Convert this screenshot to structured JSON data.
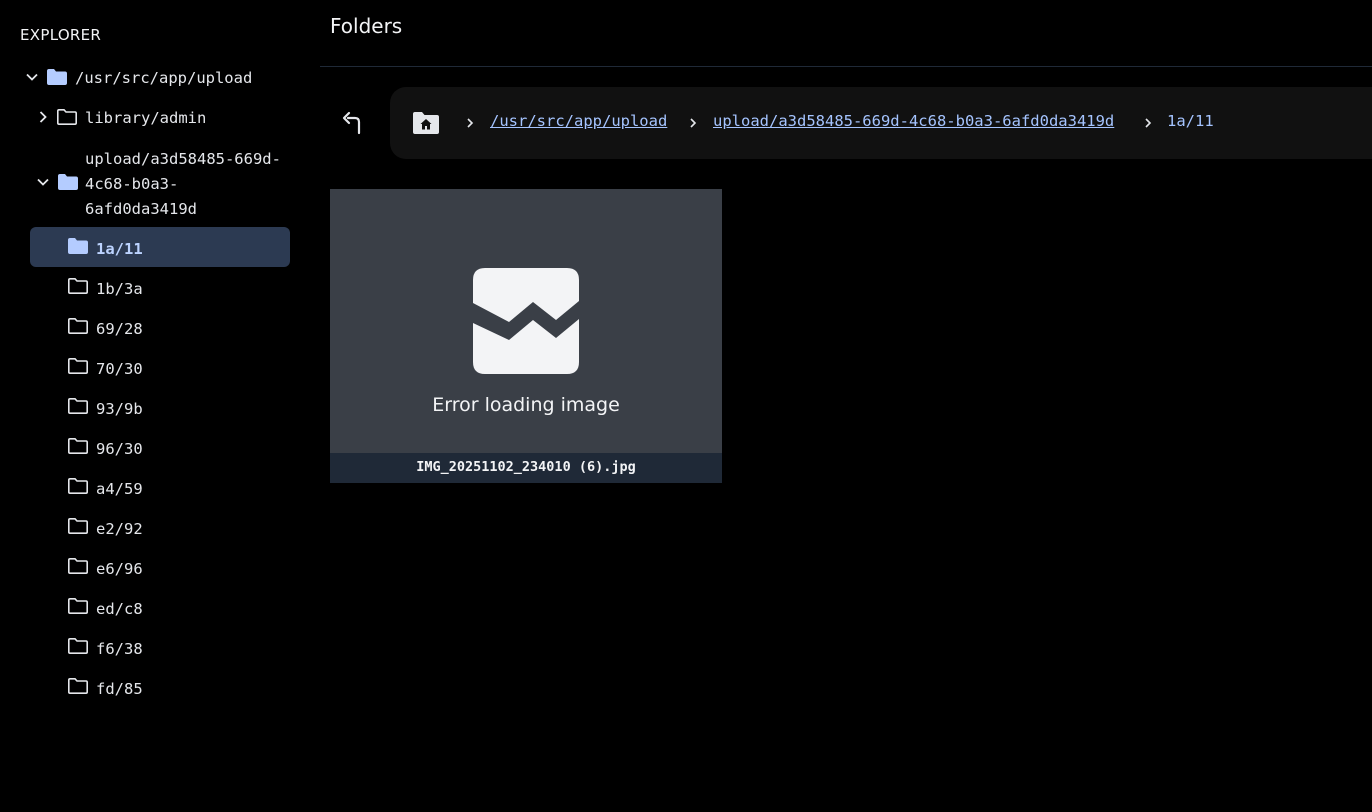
{
  "sidebar": {
    "title": "EXPLORER",
    "root": {
      "label": "/usr/src/app/upload",
      "expanded": true
    },
    "items": [
      {
        "label": "library/admin",
        "expanded": false
      },
      {
        "label_lines": [
          "upload/a3d58485-669d-",
          "4c68-b0a3-",
          "6afd0da3419d"
        ],
        "expanded": true
      }
    ],
    "children": [
      {
        "label": "1a/11",
        "selected": true
      },
      {
        "label": "1b/3a"
      },
      {
        "label": "69/28"
      },
      {
        "label": "70/30"
      },
      {
        "label": "93/9b"
      },
      {
        "label": "96/30"
      },
      {
        "label": "a4/59"
      },
      {
        "label": "e2/92"
      },
      {
        "label": "e6/96"
      },
      {
        "label": "ed/c8"
      },
      {
        "label": "f6/38"
      },
      {
        "label": "fd/85"
      }
    ]
  },
  "main": {
    "title": "Folders",
    "breadcrumb": {
      "links": [
        "/usr/src/app/upload",
        "upload/a3d58485-669d-4c68-b0a3-6afd0da3419d"
      ],
      "current": "1a/11"
    },
    "thumbnail": {
      "error_text": "Error loading image",
      "filename": "IMG_20251102_234010 (6).jpg"
    }
  },
  "colors": {
    "background": "#000000",
    "selected_bg": "#2c3a52",
    "accent": "#a5c4ff",
    "folder_filled": "#b4ccff"
  },
  "icons": {
    "up": "arrow-up-left-icon",
    "home": "folder-home-icon",
    "folder": "folder-icon",
    "broken_image": "broken-image-icon"
  }
}
